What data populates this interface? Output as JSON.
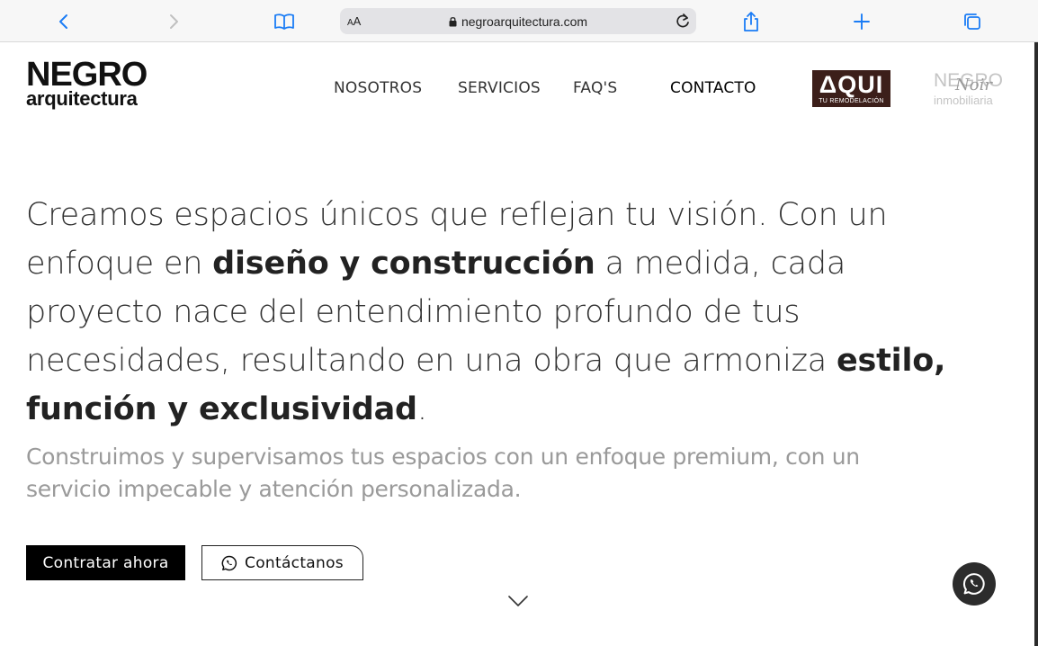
{
  "browser": {
    "url": "negroarquitectura.com",
    "text_size_small": "A",
    "text_size_big": "A",
    "icons": [
      "back-icon",
      "forward-icon",
      "bookmarks-icon",
      "lock-icon",
      "reload-icon",
      "share-icon",
      "new-tab-icon",
      "tabs-icon"
    ]
  },
  "header": {
    "logo_top": "NEGRO",
    "logo_bottom": "arquitectura",
    "nav": [
      {
        "label": "NOSOTROS"
      },
      {
        "label": "SERVICIOS"
      },
      {
        "label": "FAQ'S"
      },
      {
        "label": "CONTACTO"
      }
    ],
    "partner_aqui": {
      "main": "ΔQUI",
      "sub": "TU REMODELACIÓN"
    },
    "partner_noir": {
      "top": "NEGRO",
      "script": "Noir",
      "bottom": "inmobiliaria"
    }
  },
  "hero": {
    "line1": "Creamos espacios únicos que reflejan tu visión. Con un",
    "line2_pre": "enfoque en ",
    "line2_bold": "diseño y construcción",
    "line2_post": " a medida, cada",
    "line3": "proyecto nace del entendimiento profundo de tus",
    "line4_pre": "necesidades, resultando en una obra que armoniza ",
    "line4_bold": "estilo,",
    "line5_bold": "función y exclusividad",
    "line5_post": ".",
    "subtitle_line1": "Construimos y supervisamos tus espacios con un enfoque premium, con un",
    "subtitle_line2": "servicio impecable y atención personalizada.",
    "cta_primary": "Contratar ahora",
    "cta_secondary": "Contáctanos"
  },
  "colors": {
    "accent": "#000000",
    "aqui_brand": "#3c1f1a",
    "subtitle_gray": "#9a9a9a",
    "whatsapp_float_bg": "#2c2c2c"
  }
}
